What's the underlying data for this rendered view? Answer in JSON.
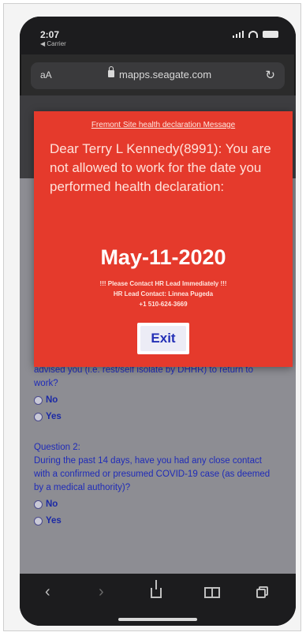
{
  "status_bar": {
    "time": "2:07",
    "carrier": "◀ Carrier"
  },
  "address_bar": {
    "text_size": "aA",
    "url": "mapps.seagate.com",
    "reload": "↻"
  },
  "modal": {
    "title": "Fremont Site health declaration Message",
    "message": "Dear Terry L Kennedy(8991): You are not allowed to work for the date you performed health declaration:",
    "date": "May-11-2020",
    "contact_line1": "!!! Please Contact HR Lead Immediately !!!",
    "contact_line2": "HR Lead Contact: Linnea Pugeda",
    "contact_line3": "+1 510-624-3669",
    "exit_label": "Exit"
  },
  "form": {
    "q1_tail": "advised you (i.e. rest/self isolate by DHHR) to return to work?",
    "q1_options": [
      "No",
      "Yes"
    ],
    "q2_title": "Question 2:",
    "q2_text": "During the past 14 days, have you had any close contact with a confirmed or presumed COVID-19 case (as deemed by a medical authority)?",
    "q2_options": [
      "No",
      "Yes"
    ]
  },
  "toolbar": {
    "back": "‹",
    "forward": "›"
  },
  "colors": {
    "modal_bg": "#e53a2c",
    "exit_text": "#2430b6",
    "form_text": "#1f2bb8"
  }
}
